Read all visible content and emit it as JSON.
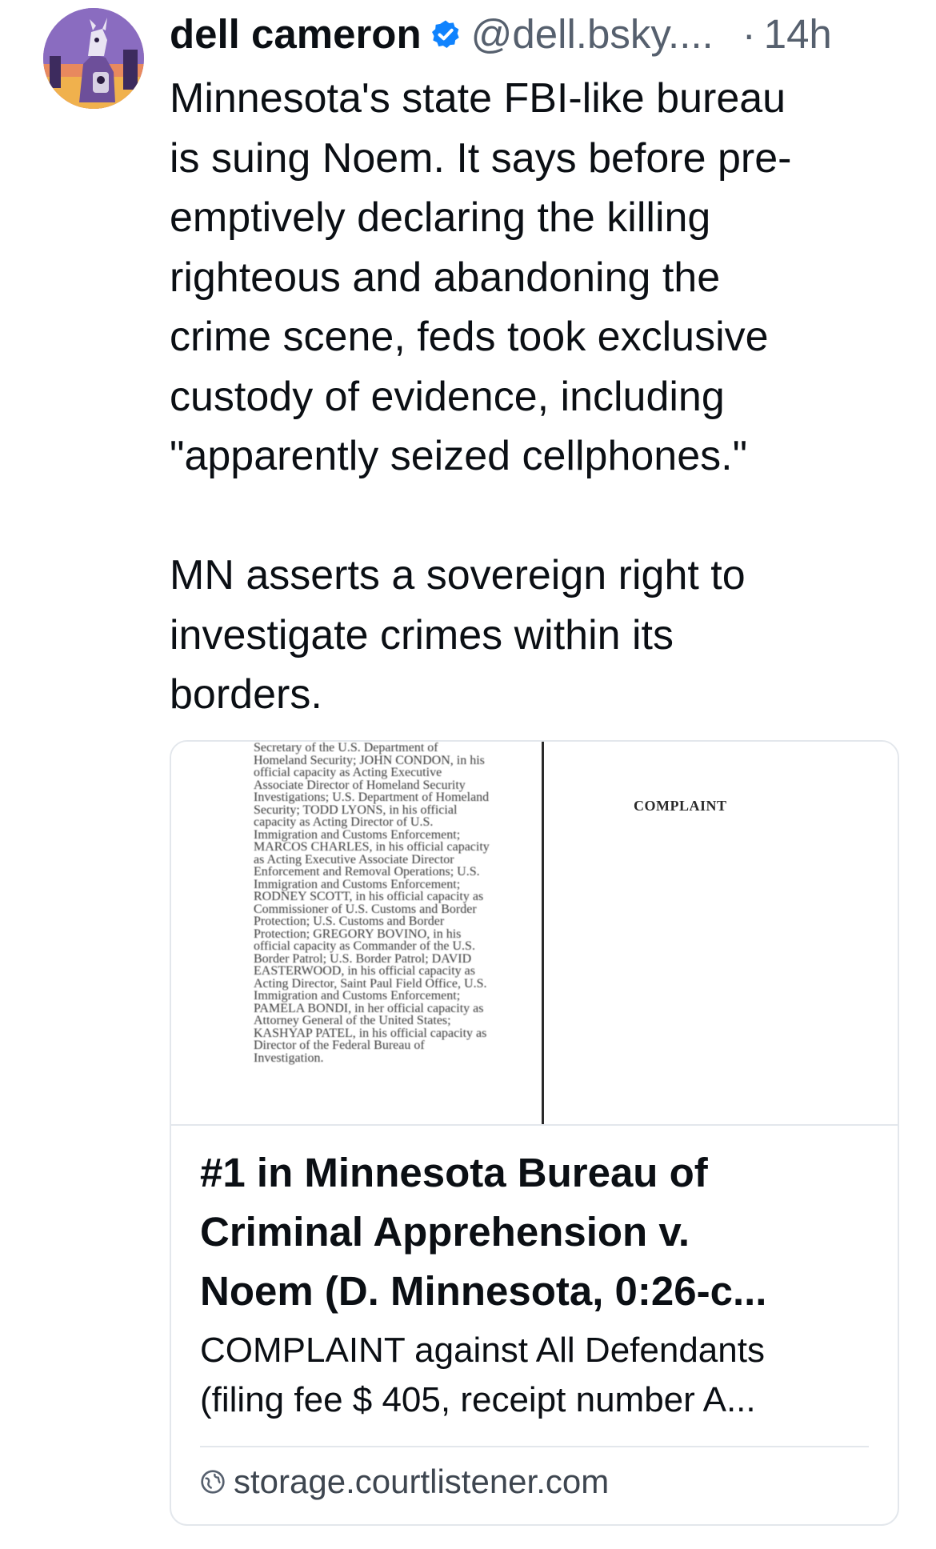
{
  "post": {
    "author": {
      "display_name": "dell cameron",
      "handle": "@dell.bsky....",
      "verified": true
    },
    "separator": "·",
    "time": "14h",
    "text": "Minnesota's state FBI-like bureau\nis suing Noem. It says before pre-\nemptively declaring the killing\nrighteous and abandoning the\ncrime scene, feds took exclusive\ncustody of evidence, including\n\"apparently seized cellphones.\"\n\nMN asserts a sovereign right to\ninvestigate crimes within its\nborders.",
    "link_card": {
      "thumbnail": {
        "left_column_text": "Secretary of the U.S. Department of\nHomeland Security; JOHN CONDON, in his\nofficial capacity as Acting Executive\nAssociate Director of Homeland Security\nInvestigations; U.S. Department of Homeland\nSecurity; TODD LYONS, in his official\ncapacity as Acting Director of U.S.\nImmigration and Customs Enforcement;\nMARCOS CHARLES, in his official capacity\nas Acting Executive Associate Director\nEnforcement and Removal Operations; U.S.\nImmigration and Customs Enforcement;\nRODNEY SCOTT, in his official capacity as\nCommissioner of U.S. Customs and Border\nProtection; U.S. Customs and Border\nProtection; GREGORY BOVINO, in his\nofficial capacity as Commander of the U.S.\nBorder Patrol; U.S. Border Patrol; DAVID\nEASTERWOOD, in his official capacity as\nActing Director, Saint Paul Field Office, U.S.\nImmigration and Customs Enforcement;\nPAMELA BONDI, in her official capacity as\nAttorney General of the United States;\nKASHYAP PATEL, in his official capacity as\nDirector of the Federal Bureau of\nInvestigation.",
        "right_column_text": "COMPLAINT"
      },
      "title": "#1 in Minnesota Bureau of\nCriminal Apprehension v.\nNoem (D. Minnesota, 0:26-c...",
      "description": "COMPLAINT against All Defendants\n(filing fee $ 405, receipt number A...",
      "domain": "storage.courtlistener.com",
      "domain_icon": "globe-icon"
    }
  },
  "colors": {
    "text_primary": "#0b0f14",
    "text_secondary": "#56606e",
    "verified_badge": "#1083fe",
    "card_border": "#e3e7ec"
  }
}
